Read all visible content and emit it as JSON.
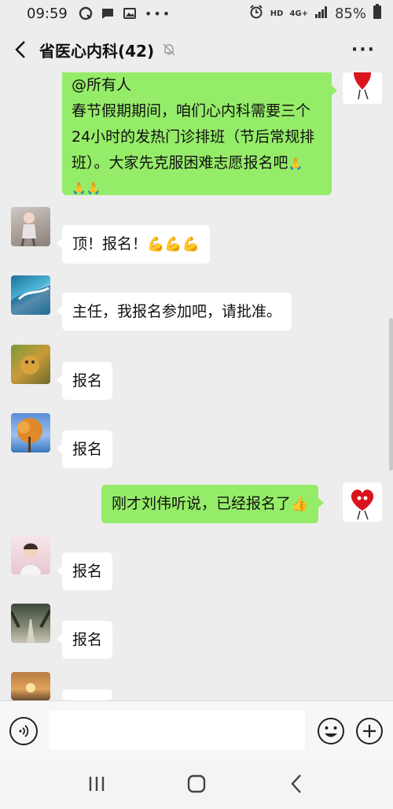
{
  "status_bar": {
    "time": "09:59",
    "hd": "HD",
    "network": "4G+",
    "battery": "85%"
  },
  "header": {
    "title": "省医心内科(42)",
    "more": "···"
  },
  "messages": [
    {
      "side": "out",
      "text_lines": [
        "@所有人",
        "春节假期期间，咱们心内科需要三个",
        "24小时的发热门诊排班（节后常规排",
        "班）。大家先克服困难志愿报名吧"
      ],
      "emoji": "🙏🙏🙏"
    },
    {
      "side": "in",
      "text": "顶！报名！",
      "emoji": "💪💪💪"
    },
    {
      "side": "in",
      "text": "主任，我报名参加吧，请批准。"
    },
    {
      "side": "in",
      "text": "报名"
    },
    {
      "side": "in",
      "text": "报名"
    },
    {
      "side": "out",
      "text": "刚才刘伟听说，已经报名了",
      "emoji": "👍"
    },
    {
      "side": "in",
      "text": "报名"
    },
    {
      "side": "in",
      "text": "报名"
    },
    {
      "side": "in",
      "text": ""
    }
  ],
  "input": {
    "value": "",
    "placeholder": ""
  },
  "colors": {
    "out_bubble": "#95ec69",
    "in_bubble": "#ffffff",
    "background": "#ededed"
  },
  "icons": {
    "back": "back-arrow-icon",
    "mute": "bell-off-icon",
    "voice": "voice-icon",
    "emoji": "smiley-icon",
    "plus": "plus-icon",
    "nav_recents": "recents-icon",
    "nav_home": "home-icon",
    "nav_back": "nav-back-icon"
  }
}
